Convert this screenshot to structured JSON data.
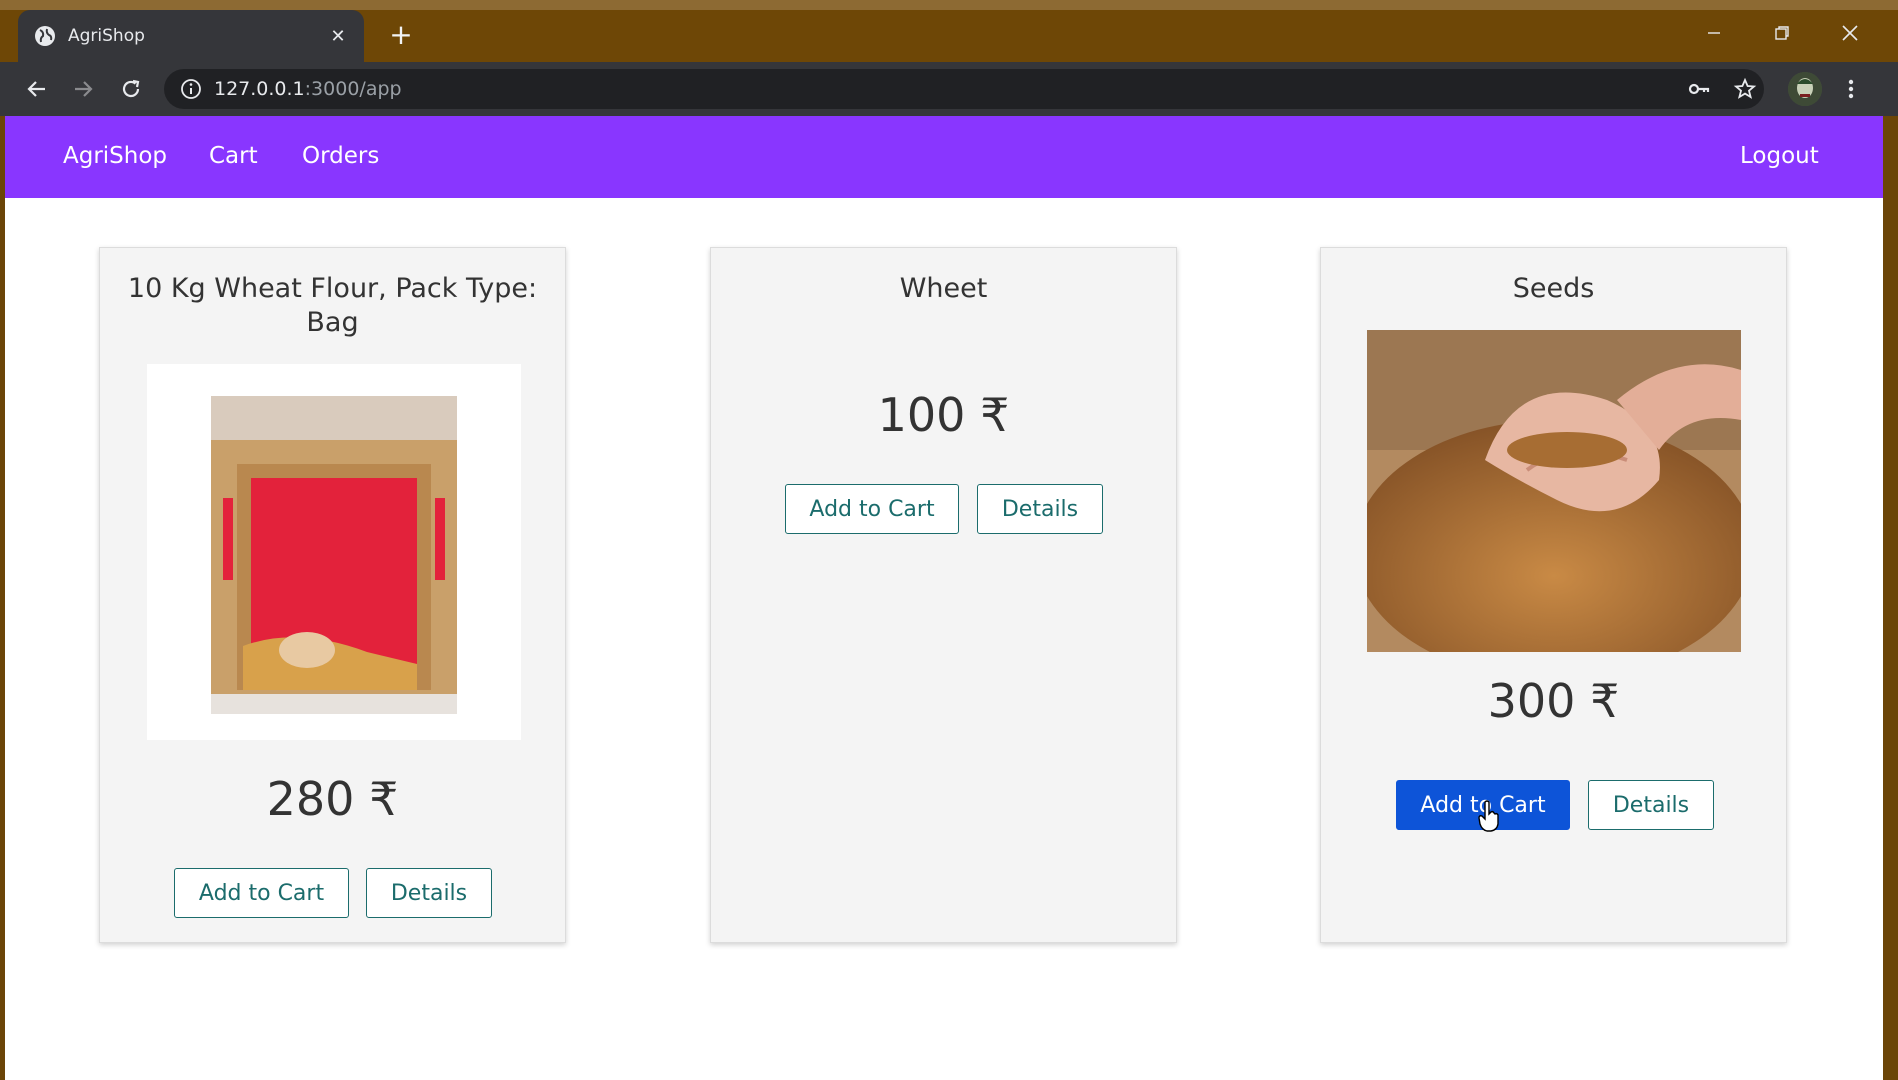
{
  "browser": {
    "tab_title": "AgriShop",
    "new_tab_symbol": "+",
    "url_host": "127.0.0.1",
    "url_rest": ":3000/app"
  },
  "navbar": {
    "brand": "AgriShop",
    "links": [
      "Cart",
      "Orders"
    ],
    "logout": "Logout",
    "color": "#8936ff"
  },
  "products": [
    {
      "title": "10 Kg Wheat Flour, Pack Type: Bag",
      "price": "280 ₹",
      "add_label": "Add to Cart",
      "details_label": "Details",
      "image": "wheat-flour-bag-image"
    },
    {
      "title": "Wheet",
      "price": "100 ₹",
      "add_label": "Add to Cart",
      "details_label": "Details"
    },
    {
      "title": "Seeds",
      "price": "300 ₹",
      "add_label": "Add to Cart",
      "details_label": "Details",
      "image": "seeds-in-hands-image"
    }
  ]
}
